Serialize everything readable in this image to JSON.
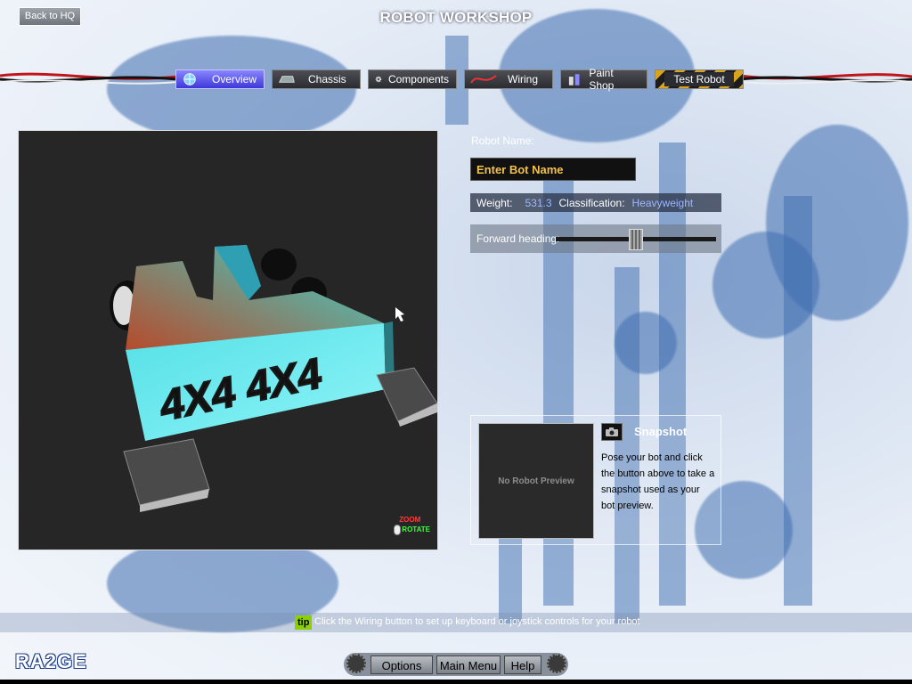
{
  "header": {
    "back_label": "Back to HQ",
    "title": "ROBOT WORKSHOP"
  },
  "tabs": [
    {
      "label": "Overview",
      "icon": "globe-icon",
      "active": true
    },
    {
      "label": "Chassis",
      "icon": "chassis-icon",
      "active": false
    },
    {
      "label": "Components",
      "icon": "gear-icon",
      "active": false
    },
    {
      "label": "Wiring",
      "icon": "wire-icon",
      "active": false
    },
    {
      "label": "Paint Shop",
      "icon": "paint-icon",
      "active": false
    },
    {
      "label": "Test Robot",
      "icon": "",
      "active": false
    }
  ],
  "viewport": {
    "robot_decal": "4X4 4X4",
    "zoom_label": "ZOOM",
    "rotate_label": "ROTATE"
  },
  "robot": {
    "name_label": "Robot Name:",
    "name_placeholder": "Enter Bot Name",
    "weight_label": "Weight:",
    "weight_value": "531.3",
    "class_label": "Classification:",
    "class_value": "Heavyweight",
    "heading_label": "Forward heading:",
    "heading_value": 0.5
  },
  "snapshot": {
    "preview_text": "No Robot Preview",
    "label": "Snapshot",
    "description": "Pose your bot and click the button above to take a snapshot used as your bot preview."
  },
  "tip": {
    "badge": "tip",
    "text": "Click the Wiring button to set up keyboard or joystick controls for your robot"
  },
  "footer": {
    "logo": "RA2GE",
    "options": "Options",
    "main_menu": "Main Menu",
    "help": "Help"
  },
  "colors": {
    "active_tab": "#5a55f0",
    "name_text": "#f2c24a",
    "class_text": "#9db6ff",
    "tip_badge": "#8bd000"
  }
}
